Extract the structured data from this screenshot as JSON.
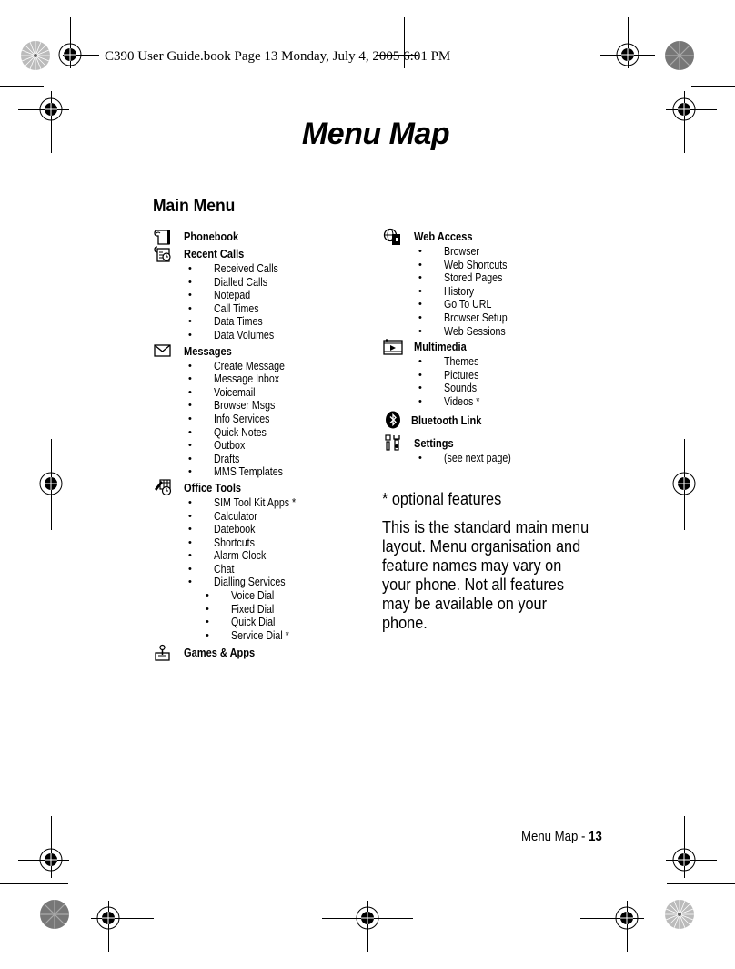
{
  "header": {
    "print_info": "C390 User Guide.book  Page 13  Monday, July 4, 2005  6:01 PM"
  },
  "page": {
    "title": "Menu Map",
    "section_title": "Main Menu"
  },
  "left_column": [
    {
      "icon": "phonebook-icon",
      "label": "Phonebook",
      "items": []
    },
    {
      "icon": "recent-calls-icon",
      "label": "Recent Calls",
      "items": [
        "Received Calls",
        "Dialled Calls",
        "Notepad",
        "Call Times",
        "Data Times",
        "Data Volumes"
      ]
    },
    {
      "icon": "envelope-icon",
      "label": "Messages",
      "items": [
        "Create Message",
        "Message Inbox",
        "Voicemail",
        "Browser Msgs",
        "Info Services",
        "Quick Notes",
        "Outbox",
        "Drafts",
        "MMS Templates"
      ]
    },
    {
      "icon": "office-tools-icon",
      "label": "Office Tools",
      "items": [
        "SIM Tool Kit Apps *",
        "Calculator",
        "Datebook",
        "Shortcuts",
        "Alarm Clock",
        "Chat",
        "Dialling Services"
      ],
      "subitems": [
        "Voice Dial",
        "Fixed Dial",
        "Quick Dial",
        "Service Dial *"
      ]
    },
    {
      "icon": "joystick-icon",
      "label": "Games & Apps",
      "items": []
    }
  ],
  "right_column": [
    {
      "icon": "globe-icon",
      "label": "Web Access",
      "items": [
        "Browser",
        "Web Shortcuts",
        "Stored Pages",
        "History",
        "Go To URL",
        "Browser Setup",
        "Web Sessions"
      ]
    },
    {
      "icon": "film-icon",
      "label": "Multimedia",
      "items": [
        "Themes",
        "Pictures",
        "Sounds",
        "Videos *"
      ]
    },
    {
      "icon": "bluetooth-icon",
      "label": "Bluetooth Link",
      "items": []
    },
    {
      "icon": "settings-icon",
      "label": "Settings",
      "items": [
        "(see next page)"
      ]
    }
  ],
  "notes": {
    "optional": "* optional features",
    "description_lines": [
      "This is the standard main menu",
      "layout. Menu organisation and",
      "feature names may vary on",
      "your phone. Not all features",
      "may be available on your",
      "phone."
    ]
  },
  "footer": {
    "section": "Menu Map - ",
    "page_number": "13"
  }
}
